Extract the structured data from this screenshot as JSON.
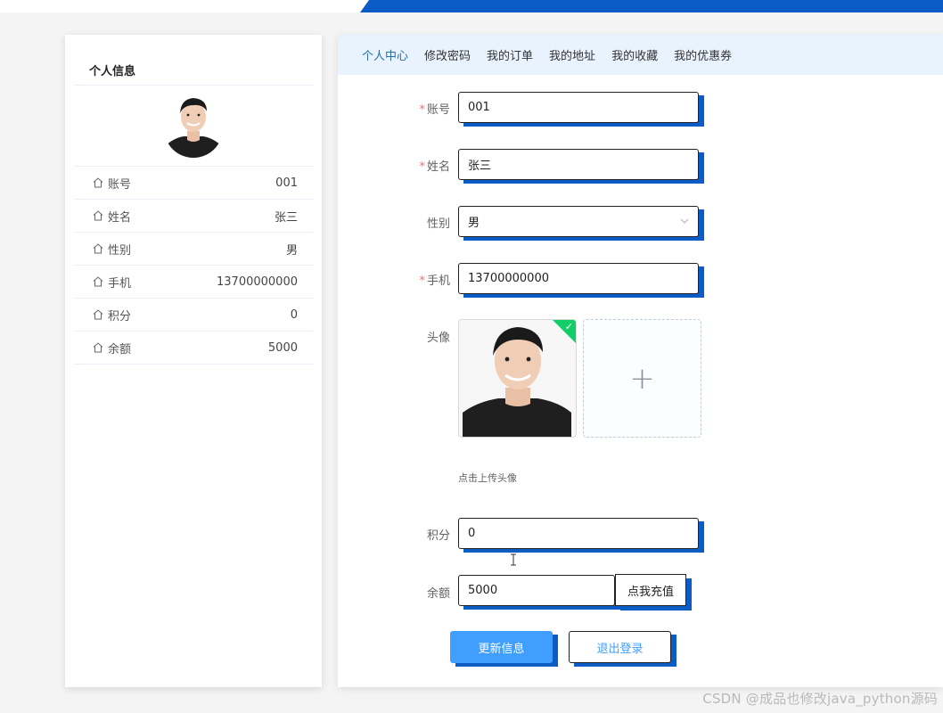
{
  "left_panel": {
    "title": "个人信息",
    "items": [
      {
        "label": "账号",
        "value": "001",
        "icon": "home-icon"
      },
      {
        "label": "姓名",
        "value": "张三",
        "icon": "home-icon"
      },
      {
        "label": "性别",
        "value": "男",
        "icon": "home-icon"
      },
      {
        "label": "手机",
        "value": "13700000000",
        "icon": "home-icon"
      },
      {
        "label": "积分",
        "value": "0",
        "icon": "home-icon"
      },
      {
        "label": "余额",
        "value": "5000",
        "icon": "home-icon"
      }
    ]
  },
  "tabs": [
    {
      "label": "个人中心",
      "active": true
    },
    {
      "label": "修改密码",
      "active": false
    },
    {
      "label": "我的订单",
      "active": false
    },
    {
      "label": "我的地址",
      "active": false
    },
    {
      "label": "我的收藏",
      "active": false
    },
    {
      "label": "我的优惠券",
      "active": false
    }
  ],
  "form": {
    "account": {
      "label": "账号",
      "value": "001",
      "required": true
    },
    "name": {
      "label": "姓名",
      "value": "张三",
      "required": true
    },
    "gender": {
      "label": "性别",
      "value": "男"
    },
    "phone": {
      "label": "手机",
      "value": "13700000000",
      "required": true
    },
    "avatar": {
      "label": "头像",
      "tip": "点击上传头像"
    },
    "points": {
      "label": "积分",
      "value": "0"
    },
    "balance": {
      "label": "余额",
      "value": "5000",
      "recharge_label": "点我充值"
    },
    "required_mark": "*"
  },
  "actions": {
    "update_label": "更新信息",
    "logout_label": "退出登录"
  },
  "watermark": "CSDN @成品也修改java_python源码",
  "colors": {
    "accent_blue": "#0b5cc4",
    "primary": "#409eff",
    "tab_bg": "#e8f3fe",
    "success": "#13ce66",
    "required": "#f56c6c"
  }
}
